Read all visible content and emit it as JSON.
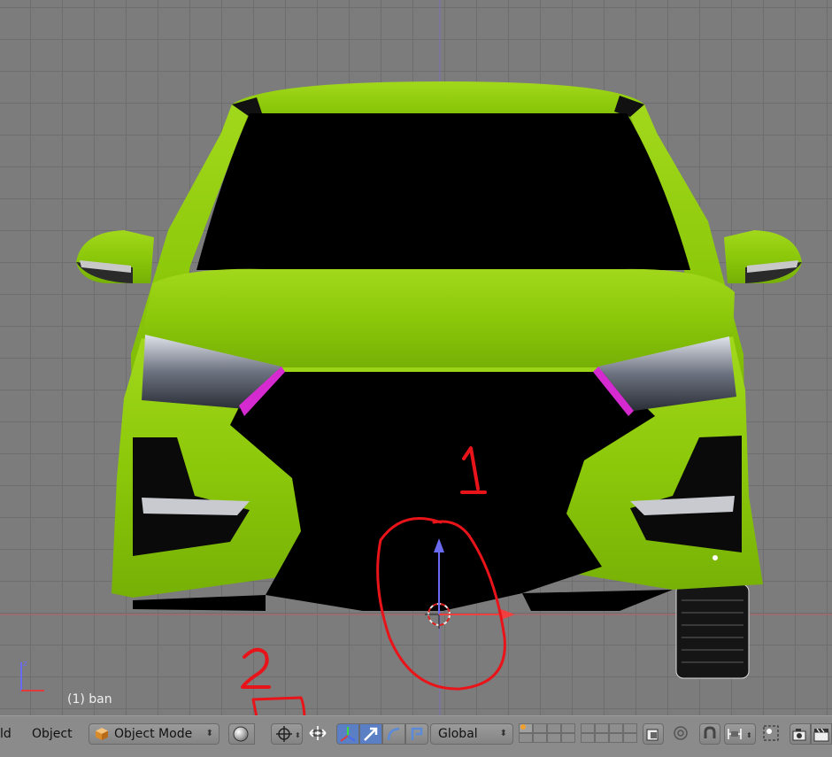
{
  "viewport": {
    "object_label": "(1) ban"
  },
  "header": {
    "menu_partial": "ld",
    "menu_object": "Object",
    "mode": "Object Mode",
    "orientation": "Global"
  },
  "annotations": {
    "mark_1": "1",
    "mark_2": "2"
  },
  "colors": {
    "body_green": "#8cc80a",
    "annotation_red": "#e8141a",
    "grid": "#6e6e6e",
    "viewport_bg": "#7c7c7c"
  },
  "icons": [
    "cube-icon",
    "solid-shade-icon",
    "pivot-icon",
    "manipulator-icon",
    "translate-icon",
    "rotate-icon",
    "scale-icon",
    "layer-grid-icon",
    "lock-icon",
    "proportional-icon",
    "snap-icon",
    "render-icon",
    "camera-icon",
    "clapper-icon"
  ]
}
